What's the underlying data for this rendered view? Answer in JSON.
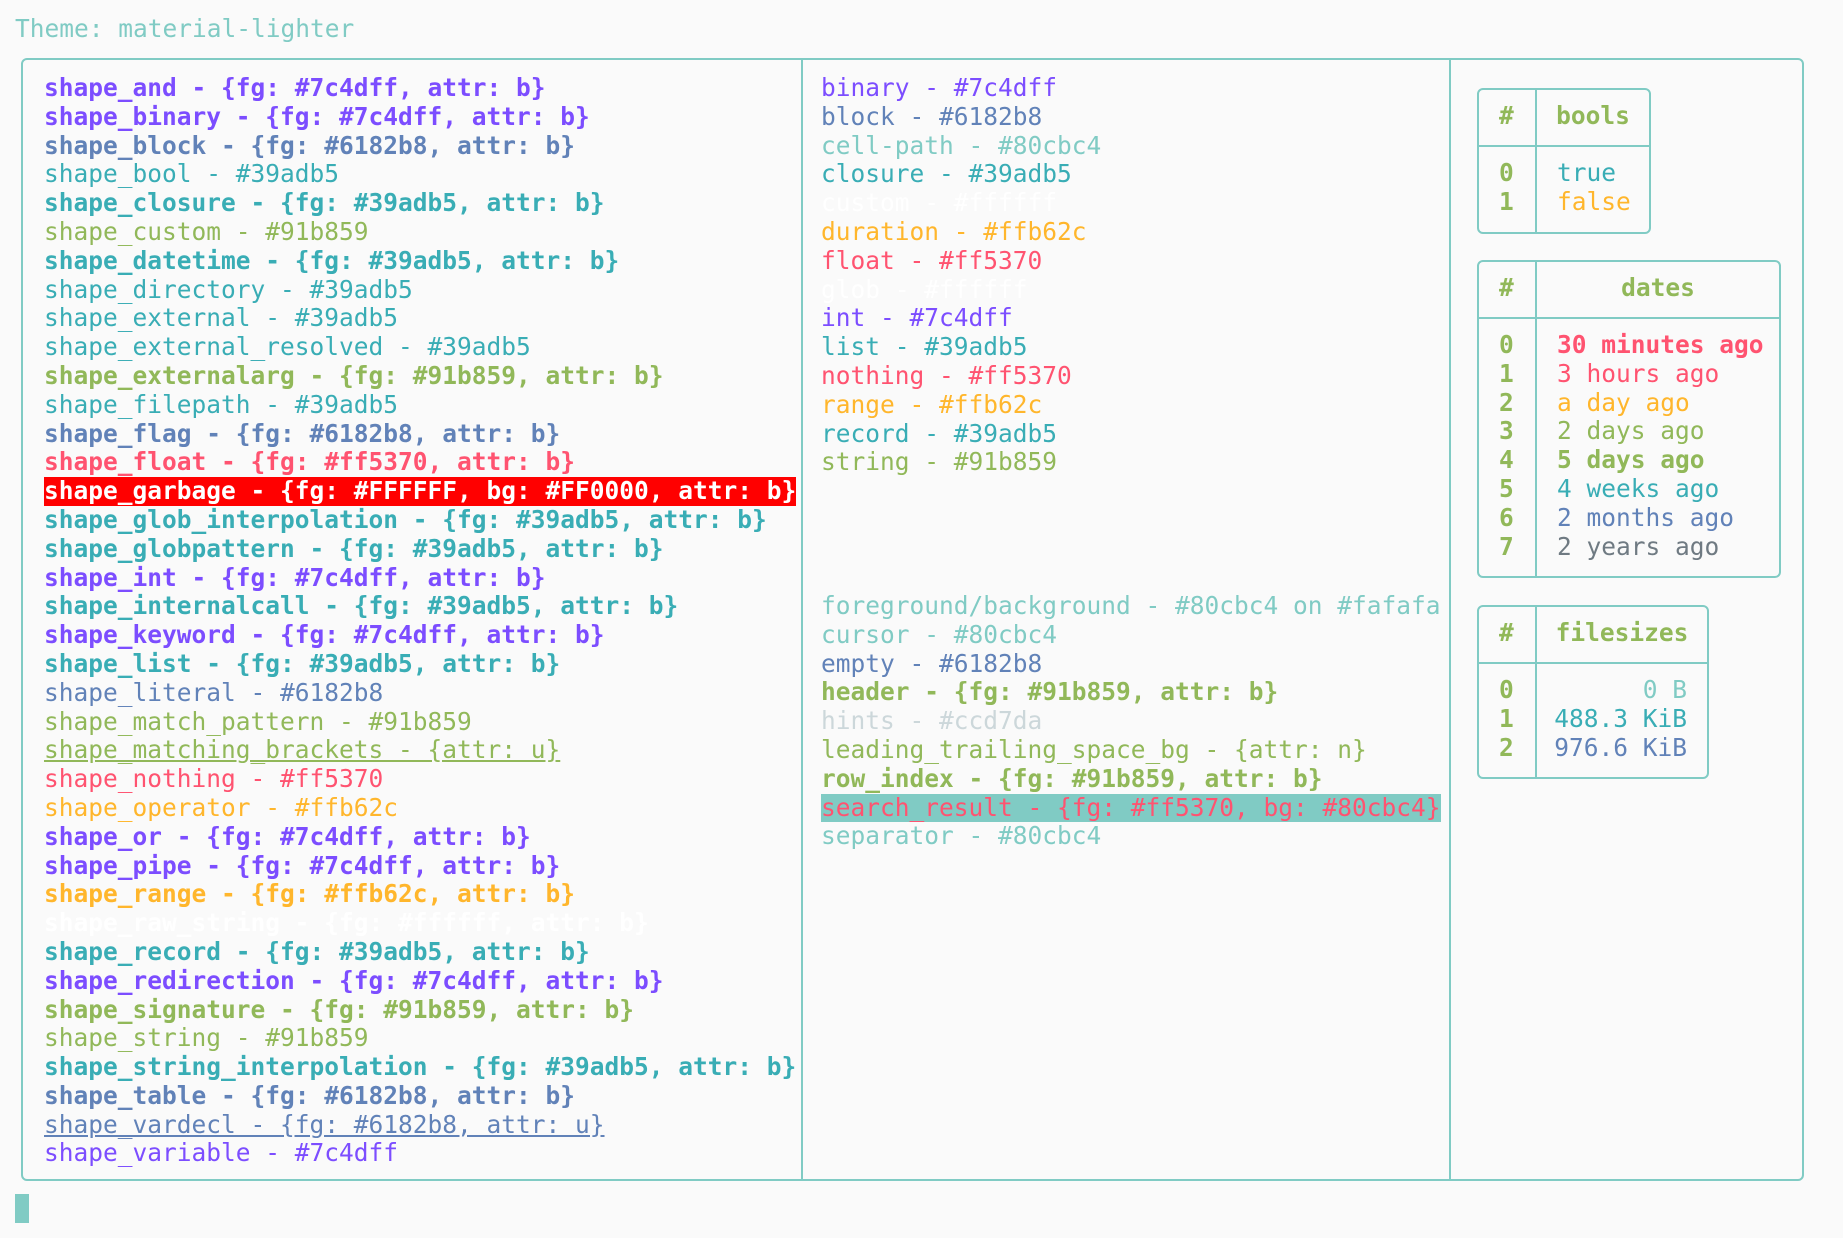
{
  "theme_line": "Theme: material-lighter",
  "shapes": [
    {
      "text": "shape_and - {fg: #7c4dff, attr: b}",
      "color": "#7c4dff",
      "bold": true
    },
    {
      "text": "shape_binary - {fg: #7c4dff, attr: b}",
      "color": "#7c4dff",
      "bold": true
    },
    {
      "text": "shape_block - {fg: #6182b8, attr: b}",
      "color": "#6182b8",
      "bold": true
    },
    {
      "text": "shape_bool - #39adb5",
      "color": "#39adb5"
    },
    {
      "text": "shape_closure - {fg: #39adb5, attr: b}",
      "color": "#39adb5",
      "bold": true
    },
    {
      "text": "shape_custom - #91b859",
      "color": "#91b859"
    },
    {
      "text": "shape_datetime - {fg: #39adb5, attr: b}",
      "color": "#39adb5",
      "bold": true
    },
    {
      "text": "shape_directory - #39adb5",
      "color": "#39adb5"
    },
    {
      "text": "shape_external - #39adb5",
      "color": "#39adb5"
    },
    {
      "text": "shape_external_resolved - #39adb5",
      "color": "#39adb5"
    },
    {
      "text": "shape_externalarg - {fg: #91b859, attr: b}",
      "color": "#91b859",
      "bold": true
    },
    {
      "text": "shape_filepath - #39adb5",
      "color": "#39adb5"
    },
    {
      "text": "shape_flag - {fg: #6182b8, attr: b}",
      "color": "#6182b8",
      "bold": true
    },
    {
      "text": "shape_float - {fg: #ff5370, attr: b}",
      "color": "#ff5370",
      "bold": true
    },
    {
      "text": "shape_garbage - {fg: #FFFFFF, bg: #FF0000, attr: b}",
      "color": "#FFFFFF",
      "bg": "#FF0000",
      "bold": true
    },
    {
      "text": "shape_glob_interpolation - {fg: #39adb5, attr: b}",
      "color": "#39adb5",
      "bold": true
    },
    {
      "text": "shape_globpattern - {fg: #39adb5, attr: b}",
      "color": "#39adb5",
      "bold": true
    },
    {
      "text": "shape_int - {fg: #7c4dff, attr: b}",
      "color": "#7c4dff",
      "bold": true
    },
    {
      "text": "shape_internalcall - {fg: #39adb5, attr: b}",
      "color": "#39adb5",
      "bold": true
    },
    {
      "text": "shape_keyword - {fg: #7c4dff, attr: b}",
      "color": "#7c4dff",
      "bold": true
    },
    {
      "text": "shape_list - {fg: #39adb5, attr: b}",
      "color": "#39adb5",
      "bold": true
    },
    {
      "text": "shape_literal - #6182b8",
      "color": "#6182b8"
    },
    {
      "text": "shape_match_pattern - #91b859",
      "color": "#91b859"
    },
    {
      "text": "shape_matching_brackets - {attr: u}",
      "color": "#91b859",
      "underline": true
    },
    {
      "text": "shape_nothing - #ff5370",
      "color": "#ff5370"
    },
    {
      "text": "shape_operator - #ffb62c",
      "color": "#ffb62c"
    },
    {
      "text": "shape_or - {fg: #7c4dff, attr: b}",
      "color": "#7c4dff",
      "bold": true
    },
    {
      "text": "shape_pipe - {fg: #7c4dff, attr: b}",
      "color": "#7c4dff",
      "bold": true
    },
    {
      "text": "shape_range - {fg: #ffb62c, attr: b}",
      "color": "#ffb62c",
      "bold": true
    },
    {
      "text": "shape_raw_string - {fg: #ffffff, attr: b}",
      "color": "#ffffff",
      "bold": true
    },
    {
      "text": "shape_record - {fg: #39adb5, attr: b}",
      "color": "#39adb5",
      "bold": true
    },
    {
      "text": "shape_redirection - {fg: #7c4dff, attr: b}",
      "color": "#7c4dff",
      "bold": true
    },
    {
      "text": "shape_signature - {fg: #91b859, attr: b}",
      "color": "#91b859",
      "bold": true
    },
    {
      "text": "shape_string - #91b859",
      "color": "#91b859"
    },
    {
      "text": "shape_string_interpolation - {fg: #39adb5, attr: b}",
      "color": "#39adb5",
      "bold": true
    },
    {
      "text": "shape_table - {fg: #6182b8, attr: b}",
      "color": "#6182b8",
      "bold": true
    },
    {
      "text": "shape_vardecl - {fg: #6182b8, attr: u}",
      "color": "#6182b8",
      "underline": true
    },
    {
      "text": "shape_variable - #7c4dff",
      "color": "#7c4dff"
    }
  ],
  "types": [
    {
      "text": "binary - #7c4dff",
      "color": "#7c4dff"
    },
    {
      "text": "block - #6182b8",
      "color": "#6182b8"
    },
    {
      "text": "cell-path - #80cbc4",
      "color": "#80cbc4"
    },
    {
      "text": "closure - #39adb5",
      "color": "#39adb5"
    },
    {
      "text": "custom - #ffffff",
      "color": "#ffffff"
    },
    {
      "text": "duration - #ffb62c",
      "color": "#ffb62c"
    },
    {
      "text": "float - #ff5370",
      "color": "#ff5370"
    },
    {
      "text": "glob - #ffffff",
      "color": "#ffffff"
    },
    {
      "text": "int - #7c4dff",
      "color": "#7c4dff"
    },
    {
      "text": "list - #39adb5",
      "color": "#39adb5"
    },
    {
      "text": "nothing - #ff5370",
      "color": "#ff5370"
    },
    {
      "text": "range - #ffb62c",
      "color": "#ffb62c"
    },
    {
      "text": "record - #39adb5",
      "color": "#39adb5"
    },
    {
      "text": "string - #91b859",
      "color": "#91b859"
    }
  ],
  "ui": [
    {
      "text": "foreground/background - #80cbc4 on #fafafa",
      "color": "#80cbc4"
    },
    {
      "text": "cursor - #80cbc4",
      "color": "#80cbc4"
    },
    {
      "text": "empty - #6182b8",
      "color": "#6182b8"
    },
    {
      "text": "header - {fg: #91b859, attr: b}",
      "color": "#91b859",
      "bold": true
    },
    {
      "text": "hints - #ccd7da",
      "color": "#ccd7da"
    },
    {
      "text": "leading_trailing_space_bg - {attr: n}",
      "color": "#91b859"
    },
    {
      "text": "row_index - {fg: #91b859, attr: b}",
      "color": "#91b859",
      "bold": true
    },
    {
      "text": "search_result - {fg: #ff5370, bg: #80cbc4}",
      "color": "#ff5370",
      "bg": "#80cbc4"
    },
    {
      "text": "separator - #80cbc4",
      "color": "#80cbc4"
    }
  ],
  "bools": {
    "hash": "#",
    "title": "bools",
    "rows": [
      {
        "i": "0",
        "v": "true",
        "color": "#39adb5"
      },
      {
        "i": "1",
        "v": "false",
        "color": "#ffb62c"
      }
    ]
  },
  "dates": {
    "hash": "#",
    "title": "dates",
    "rows": [
      {
        "i": "0",
        "v": "30 minutes ago",
        "color": "#ff5370",
        "bold": true
      },
      {
        "i": "1",
        "v": "3 hours ago",
        "color": "#ff5370"
      },
      {
        "i": "2",
        "v": "a day ago",
        "color": "#ffb62c"
      },
      {
        "i": "3",
        "v": "2 days ago",
        "color": "#91b859"
      },
      {
        "i": "4",
        "v": "5 days ago",
        "color": "#91b859",
        "bold": true
      },
      {
        "i": "5",
        "v": "4 weeks ago",
        "color": "#39adb5"
      },
      {
        "i": "6",
        "v": "2 months ago",
        "color": "#6182b8"
      },
      {
        "i": "7",
        "v": "2 years ago",
        "color": "#6f7a82"
      }
    ]
  },
  "filesizes": {
    "hash": "#",
    "title": "filesizes",
    "rows": [
      {
        "i": "0",
        "v": "0 B",
        "color": "#80cbc4"
      },
      {
        "i": "1",
        "v": "488.3 KiB",
        "color": "#39adb5"
      },
      {
        "i": "2",
        "v": "976.6 KiB",
        "color": "#6182b8"
      }
    ]
  }
}
